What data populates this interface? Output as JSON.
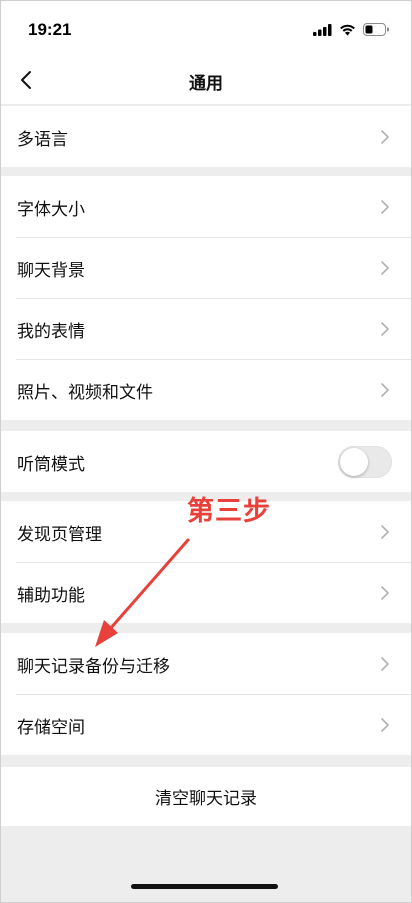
{
  "status_bar": {
    "time": "19:21",
    "icons": [
      "signal-icon",
      "wifi-icon",
      "battery-icon"
    ]
  },
  "nav": {
    "title": "通用",
    "back_icon": "chevron-left-icon"
  },
  "groups": [
    {
      "items": [
        {
          "label": "多语言",
          "control": "chevron"
        }
      ]
    },
    {
      "items": [
        {
          "label": "字体大小",
          "control": "chevron"
        },
        {
          "label": "聊天背景",
          "control": "chevron"
        },
        {
          "label": "我的表情",
          "control": "chevron"
        },
        {
          "label": "照片、视频和文件",
          "control": "chevron"
        }
      ]
    },
    {
      "items": [
        {
          "label": "听筒模式",
          "control": "toggle",
          "toggle_on": false
        }
      ]
    },
    {
      "items": [
        {
          "label": "发现页管理",
          "control": "chevron"
        },
        {
          "label": "辅助功能",
          "control": "chevron"
        }
      ]
    },
    {
      "items": [
        {
          "label": "聊天记录备份与迁移",
          "control": "chevron"
        },
        {
          "label": "存储空间",
          "control": "chevron"
        }
      ]
    }
  ],
  "clear_chat": {
    "label": "清空聊天记录"
  },
  "annotation": {
    "text": "第三步",
    "color": "#e8403a"
  },
  "colors": {
    "background": "#ededed",
    "surface": "#ffffff",
    "text": "#111111",
    "chevron": "#b2b2b2"
  }
}
